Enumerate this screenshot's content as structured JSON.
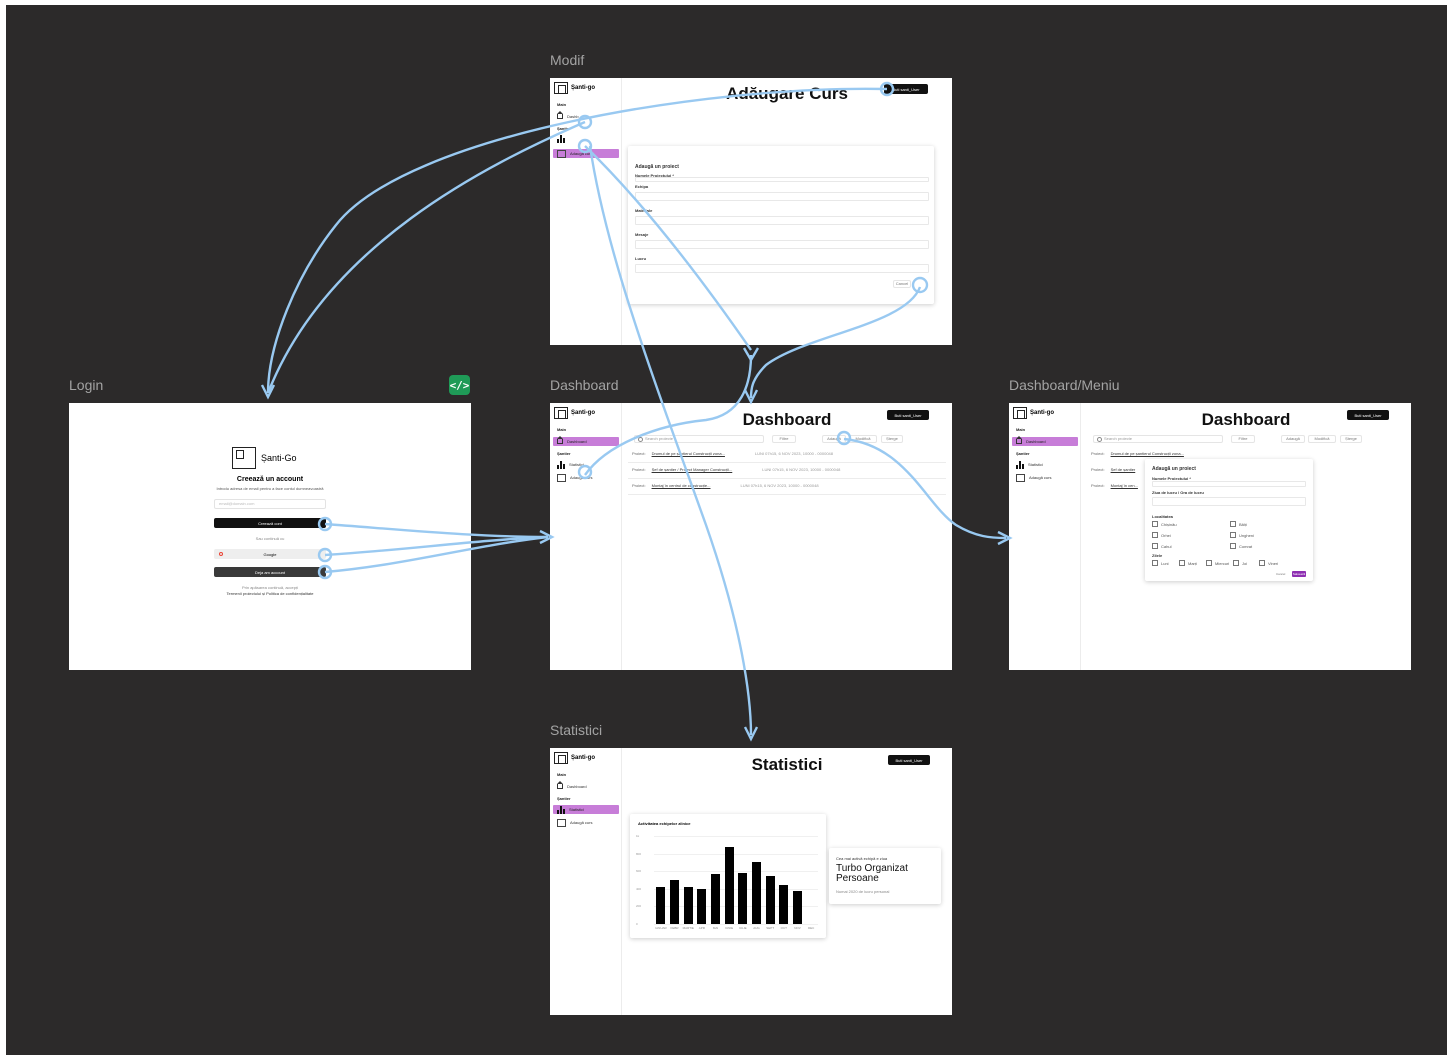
{
  "frames": {
    "modif": {
      "title": "Modif",
      "brand": "Șanti-go",
      "nav_main": "Main",
      "nav_santier": "Șantier",
      "nav_dashboard": "Dashb",
      "nav_add": "Adaugă curs",
      "page_title": "Adăugare Curs",
      "user_button": "Buti santi_User",
      "form_title": "Adaugă un proiect",
      "fields": [
        "Numele Proiectului *",
        "Echipa",
        "Materiale",
        "Mesaje",
        "Lucru"
      ],
      "cancel_label": "Cancel"
    },
    "login": {
      "title": "Login",
      "brand": "Șanti-Go",
      "heading": "Creează un account",
      "subheading": "Introdu adresa de email pentru a face contul dumneavoastră",
      "email_placeholder": "email@domain.com",
      "create_button": "Creează cont",
      "divider": "Sau continuă cu",
      "google_button": "Google",
      "existing_button": "Deja am account",
      "terms_line1": "Prin apăsarea continuă, accepți",
      "terms_line2": "Termenii proiectului și Politica de confidențialitate"
    },
    "dashboard": {
      "title": "Dashboard",
      "brand": "Șanti-go",
      "nav_main": "Main",
      "nav_dashboard": "Dashboard",
      "nav_santier": "Șantier",
      "nav_stats": "Statistici",
      "nav_add": "Adaugă curs",
      "page_title": "Dashboard",
      "user_button": "Buti santi_User",
      "search_placeholder": "Search proiecte",
      "filter": "Filtre",
      "chip_add": "Adaugă",
      "chip_edit": "Modifică",
      "chip_delete": "Șterge",
      "rows": [
        {
          "prefix": "Proiect:",
          "name": "Drumul de pe șantierul Construcții zona...",
          "meta": "LUNI 07h15, 6 NOV 2023, 10000 - 0000048"
        },
        {
          "prefix": "Proiect:",
          "name": "Șef de șantier / Project Manager Construcții...",
          "meta": "LUNI 07h15, 6 NOV 2023, 10000 - 0000048"
        },
        {
          "prefix": "Proiect:",
          "name": "Montaj în centrul de construcție...",
          "meta": "LUNI 07h15, 6 NOV 2023, 10000 - 0000048"
        }
      ]
    },
    "dashboard_menu": {
      "title": "Dashboard/Meniu",
      "brand": "Șanti-go",
      "nav_main": "Main",
      "nav_dashboard": "Dashboard",
      "nav_santier": "Șantier",
      "nav_stats": "Statistici",
      "nav_add": "Adaugă curs",
      "page_title": "Dashboard",
      "user_button": "Buti santi_User",
      "search_placeholder": "Search proiecte",
      "filter": "Filtre",
      "chip_add": "Adaugă",
      "chip_edit": "Modifică",
      "chip_delete": "Șterge",
      "row_prefix": "Proiect:",
      "row_names": [
        "Drumul de pe șantierul Construcții zona...",
        "Șef de șantier",
        "Montaj în cen..."
      ],
      "modal_title": "Adaugă un proiect",
      "modal_name_label": "Numele Proiectului *",
      "modal_date_label": "Ziua de lucru / Ora de lucru",
      "locations_label": "Localitatea",
      "locations": [
        "Chișinău",
        "Bălți",
        "Orhei",
        "Ungheni",
        "Cahul",
        "Comrat"
      ],
      "days_label": "Zilele",
      "days": [
        "Luni",
        "Marți",
        "Miercuri",
        "Joi",
        "Vineri"
      ],
      "cancel_label": "Cancel",
      "save_label": "Salvează"
    },
    "statistici": {
      "title": "Statistici",
      "brand": "Șanti-go",
      "nav_main": "Main",
      "nav_dashboard": "Dashboard",
      "nav_santier": "Șantier",
      "nav_stats": "Statistici",
      "nav_add": "Adaugă curs",
      "page_title": "Statistici",
      "user_button": "Buti santi_User",
      "chart_title": "Activitatea echipelor zilnice",
      "side_caption": "Cea mai activă echipă e ziua",
      "side_heading": "Turbo Organizat Persoane",
      "side_sub": "Numai 2020 de lucru personal"
    }
  },
  "chart_data": {
    "type": "bar",
    "title": "Activitatea echipelor zilnice",
    "categories": [
      "IANUAR",
      "FEBR",
      "MARTIE",
      "APR",
      "MAI",
      "IUNIE",
      "IULIE",
      "AUG",
      "SEPT",
      "OCT",
      "NOV",
      "DEC"
    ],
    "values": [
      42,
      50,
      42,
      40,
      57,
      88,
      58,
      71,
      55,
      44,
      38,
      0
    ],
    "ylim": [
      0,
      100
    ],
    "yticks": [
      "1k",
      "800",
      "600",
      "400",
      "200",
      "0"
    ],
    "grid": true,
    "color": "#000000"
  },
  "toolbar_icon": "code-icon",
  "colors": {
    "canvas": "#2c2a2a",
    "wire": "#99c9f1",
    "accent": "#c77dd8",
    "primary_button": "#111111",
    "save_button": "#8e2fb2",
    "code_badge": "#1f9a57"
  }
}
